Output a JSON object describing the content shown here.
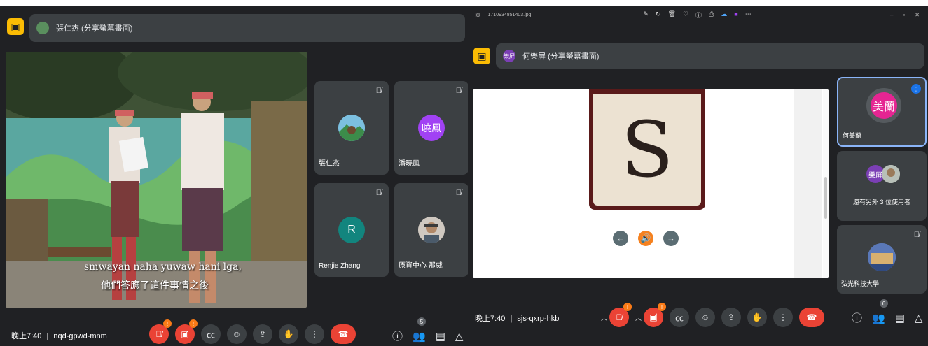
{
  "left": {
    "presenter_label": "張仁杰 (分享螢幕畫面)",
    "caption_line1": "smwayan naha yuwaw hani lga,",
    "caption_line2": "他們答應了這件事情之後",
    "tiles": [
      {
        "name": "張仁杰",
        "avatar_text": ""
      },
      {
        "name": "潘曉鳳",
        "avatar_text": "曉鳳"
      },
      {
        "name": "Renjie Zhang",
        "avatar_text": "R"
      },
      {
        "name": "原資中心 那威",
        "avatar_text": ""
      }
    ],
    "time": "晚上7:40",
    "separator": "|",
    "meeting_code": "nqd-gpwd-mnm",
    "people_count": "5",
    "badge_count": "!"
  },
  "right": {
    "file_title": "1710934851403.jpg",
    "window_controls": [
      "–",
      "▫",
      "✕"
    ],
    "toolbar_more": "⋯",
    "presenter_label": "何樂屏 (分享螢幕畫面)",
    "presenter_avatar": "樂屏",
    "slide_letter": "S",
    "tiles": [
      {
        "name": "何美蘭",
        "avatar_text": "美蘭"
      },
      {
        "name": "還有另外 3 位使用者",
        "avatar_text": "樂屏"
      },
      {
        "name": "弘光科技大學",
        "avatar_text": ""
      }
    ],
    "time": "晚上7:40",
    "separator": "|",
    "meeting_code": "sjs-qxrp-hkb",
    "people_count": "6",
    "badge_count": "!"
  },
  "colors": {
    "bg": "#202124",
    "tile": "#3c4043",
    "red": "#ea4335",
    "yellow": "#fbbc04",
    "purple": "#a142f4",
    "teal": "#12857e",
    "pink": "#e52592",
    "blue": "#1a73e8",
    "orange": "#fa7b17"
  }
}
